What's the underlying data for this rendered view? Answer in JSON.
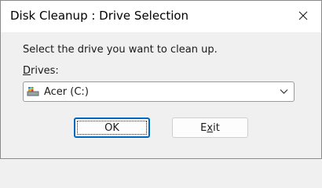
{
  "window": {
    "title": "Disk Cleanup : Drive Selection"
  },
  "titlebar": {
    "close_icon": "close-icon"
  },
  "content": {
    "prompt": "Select the drive you want to clean up.",
    "drives_label": {
      "access_key": "D",
      "rest": "rives:"
    },
    "drive_select": {
      "selected_value": "Acer (C:)",
      "icon": "drive-icon"
    }
  },
  "buttons": {
    "ok_label": "OK",
    "exit_label": {
      "before": "E",
      "access_key": "x",
      "after": "it"
    }
  },
  "colors": {
    "accent": "#0067c0",
    "titlebar": "#ffffff",
    "dialog_bg": "#f0f0f0"
  }
}
